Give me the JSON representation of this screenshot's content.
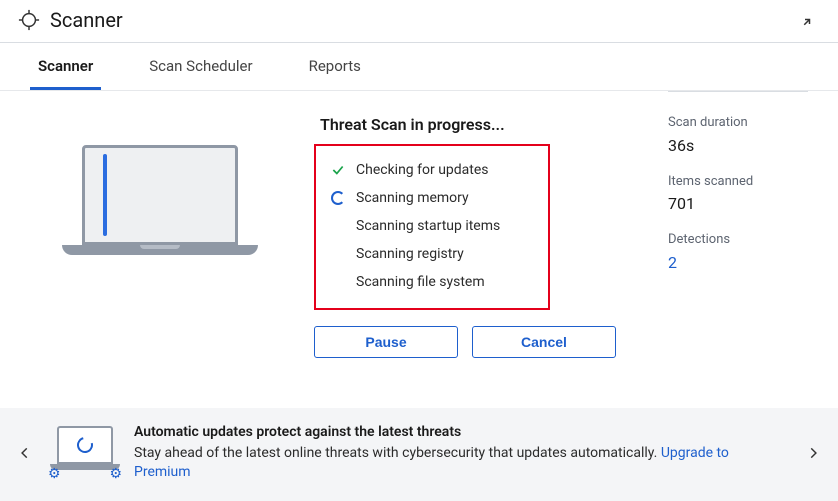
{
  "header": {
    "title": "Scanner"
  },
  "tabs": {
    "scanner": "Scanner",
    "scheduler": "Scan Scheduler",
    "reports": "Reports"
  },
  "progress": {
    "title": "Threat Scan in progress...",
    "steps": [
      {
        "label": "Checking for updates",
        "status": "done"
      },
      {
        "label": "Scanning memory",
        "status": "active"
      },
      {
        "label": "Scanning startup items",
        "status": "pending"
      },
      {
        "label": "Scanning registry",
        "status": "pending"
      },
      {
        "label": "Scanning file system",
        "status": "pending"
      }
    ]
  },
  "actions": {
    "pause": "Pause",
    "cancel": "Cancel"
  },
  "stats": {
    "duration": {
      "label": "Scan duration",
      "value": "36s"
    },
    "items": {
      "label": "Items scanned",
      "value": "701"
    },
    "detections": {
      "label": "Detections",
      "value": "2"
    }
  },
  "promo": {
    "title": "Automatic updates protect against the latest threats",
    "body": "Stay ahead of the latest online threats with cybersecurity that updates automatically. ",
    "link": "Upgrade to Premium"
  }
}
